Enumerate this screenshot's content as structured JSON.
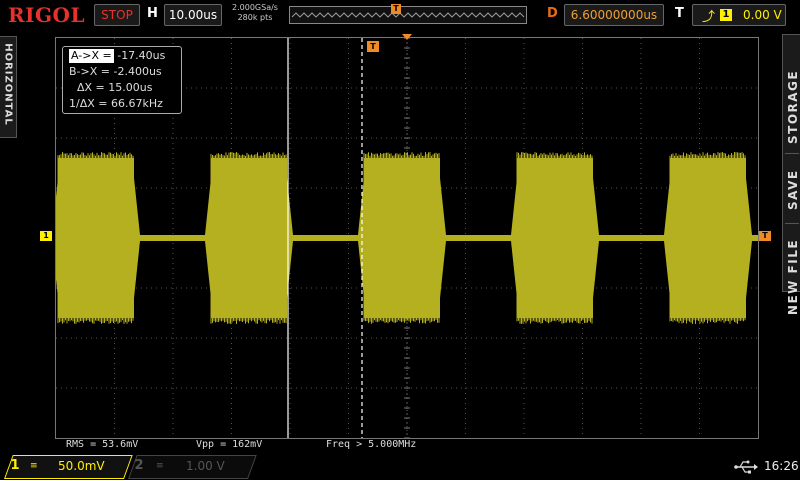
{
  "brand": "RIGOL",
  "run_state": "STOP",
  "horizontal": {
    "label": "H",
    "timebase": "10.00us"
  },
  "sample": {
    "rate": "2.000GSa/s",
    "depth": "280k pts"
  },
  "memory_trigger_marker": "T",
  "delay": {
    "label": "D",
    "value": "6.60000000us"
  },
  "trigger": {
    "label": "T",
    "edge_icon": "rising-edge-icon",
    "source": "1",
    "level": "0.00 V"
  },
  "left_tab": "HORIZONTAL",
  "right_tab": {
    "items": [
      "STORAGE",
      "SAVE",
      "NEW FILE"
    ]
  },
  "cursor_readout": {
    "a": {
      "label": "A->X =",
      "value": "-17.40us"
    },
    "b": {
      "label": "B->X =",
      "value": "-2.400us"
    },
    "delta": {
      "label": "ΔX =",
      "value": "15.00us"
    },
    "inv_delta": {
      "label": "1/ΔX =",
      "value": "66.67kHz"
    }
  },
  "markers": {
    "ch1": "1",
    "trigger_right": "T",
    "trigger_top": "T"
  },
  "measurements": [
    {
      "text": "RMS = 53.6mV"
    },
    {
      "text": "Vpp = 162mV"
    },
    {
      "text": "Freq > 5.000MHz"
    }
  ],
  "channels": [
    {
      "num": "1",
      "coupling": "≡",
      "scale": "50.0mV",
      "color": "#ffef00",
      "active": true
    },
    {
      "num": "2",
      "coupling": "≡",
      "scale": "1.00 V",
      "color": "#555555",
      "active": false
    }
  ],
  "status": {
    "usb_icon": "usb-icon",
    "clock": "16:26"
  },
  "colors": {
    "trace": "#b5b020",
    "brand": "#e8312c",
    "trigger": "#f08a24",
    "ch1": "#ffef00"
  }
}
